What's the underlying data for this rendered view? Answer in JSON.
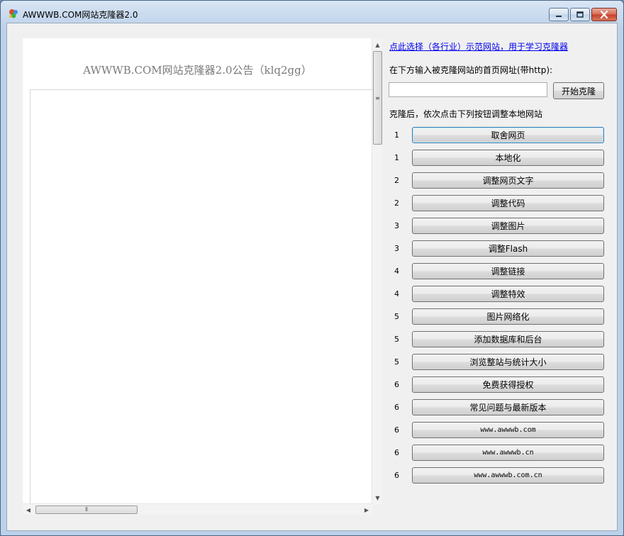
{
  "window": {
    "title": "AWWWB.COM网站克隆器2.0"
  },
  "notice": {
    "title": "AWWWB.COM网站克隆器2.0公告（klq2gg）"
  },
  "right": {
    "demo_link": "点此选择（各行业）示范网站，用于学习克隆器",
    "url_label": "在下方输入被克隆网站的首页网址(带http):",
    "url_value": "",
    "start_button": "开始克隆",
    "steps_label": "克隆后，依次点击下列按钮调整本地网站"
  },
  "steps": [
    {
      "num": "1",
      "label": "取舍网页"
    },
    {
      "num": "1",
      "label": "本地化"
    },
    {
      "num": "2",
      "label": "调整网页文字"
    },
    {
      "num": "2",
      "label": "调整代码"
    },
    {
      "num": "3",
      "label": "调整图片"
    },
    {
      "num": "3",
      "label": "调整Flash"
    },
    {
      "num": "4",
      "label": "调整链接"
    },
    {
      "num": "4",
      "label": "调整特效"
    },
    {
      "num": "5",
      "label": "图片网络化"
    },
    {
      "num": "5",
      "label": "添加数据库和后台"
    },
    {
      "num": "5",
      "label": "浏览整站与统计大小"
    },
    {
      "num": "6",
      "label": "免费获得授权"
    },
    {
      "num": "6",
      "label": "常见问题与最新版本"
    },
    {
      "num": "6",
      "label": "www.awwwb.com"
    },
    {
      "num": "6",
      "label": "www.awwwb.cn"
    },
    {
      "num": "6",
      "label": "www.awwwb.com.cn"
    }
  ],
  "colors": {
    "link": "#0000ee",
    "focus_border": "#3c7fb1",
    "close_button": "#c7402a"
  }
}
